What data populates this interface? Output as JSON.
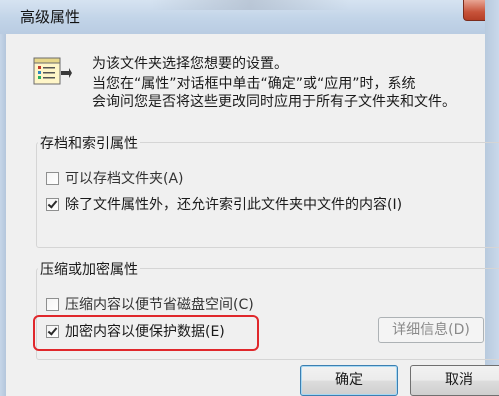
{
  "window": {
    "title": "高级属性"
  },
  "intro": {
    "line1": "为该文件夹选择您想要的设置。",
    "line2": "当您在“属性”对话框中单击“确定”或“应用”时，系统",
    "line3": "会询问您是否将这些更改同时应用于所有子文件夹和文件。"
  },
  "archive_group": {
    "label": "存档和索引属性",
    "options": [
      {
        "label": "可以存档文件夹(A)",
        "checked": false
      },
      {
        "label": "除了文件属性外，还允许索引此文件夹中文件的内容(I)",
        "checked": true
      }
    ]
  },
  "compress_group": {
    "label": "压缩或加密属性",
    "options": [
      {
        "label": "压缩内容以便节省磁盘空间(C)",
        "checked": false
      },
      {
        "label": "加密内容以便保护数据(E)",
        "checked": true
      }
    ],
    "details_button": "详细信息(D)"
  },
  "buttons": {
    "ok": "确定",
    "cancel": "取消"
  },
  "colors": {
    "highlight": "#e0272b"
  }
}
